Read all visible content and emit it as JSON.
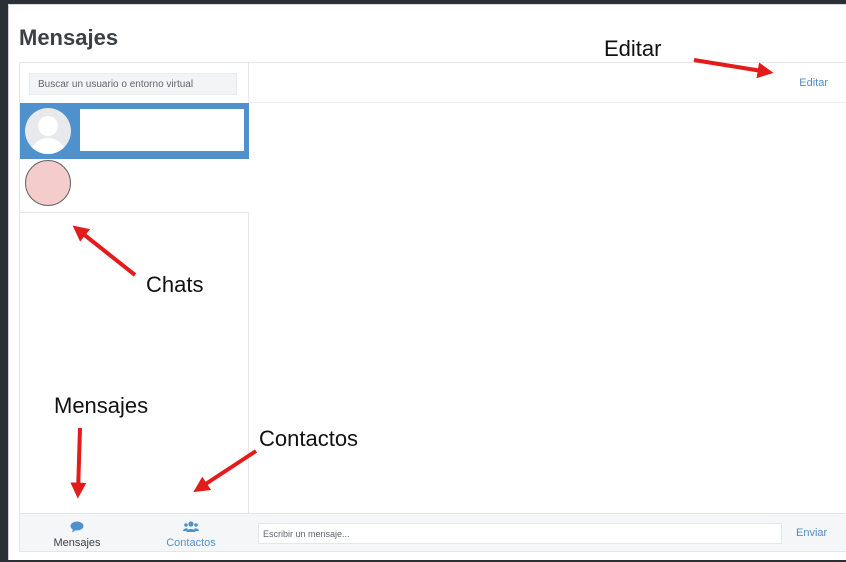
{
  "page": {
    "title": "Mensajes"
  },
  "sidebar": {
    "search_placeholder": "Buscar un usuario o entorno virtual",
    "tabs": [
      {
        "label": "Mensajes",
        "icon": "chat-bubble-icon"
      },
      {
        "label": "Contactos",
        "icon": "users-icon"
      }
    ]
  },
  "main": {
    "edit_label": "Editar",
    "message_placeholder": "Escribir un mensaje...",
    "send_label": "Enviar"
  },
  "annotations": {
    "editar": "Editar",
    "chats": "Chats",
    "mensajes": "Mensajes",
    "contactos": "Contactos"
  },
  "colors": {
    "active_chat": "#4f91cd",
    "link": "#4f8cc6",
    "arrow": "#e41b1b",
    "frame": "#2b2f36"
  }
}
